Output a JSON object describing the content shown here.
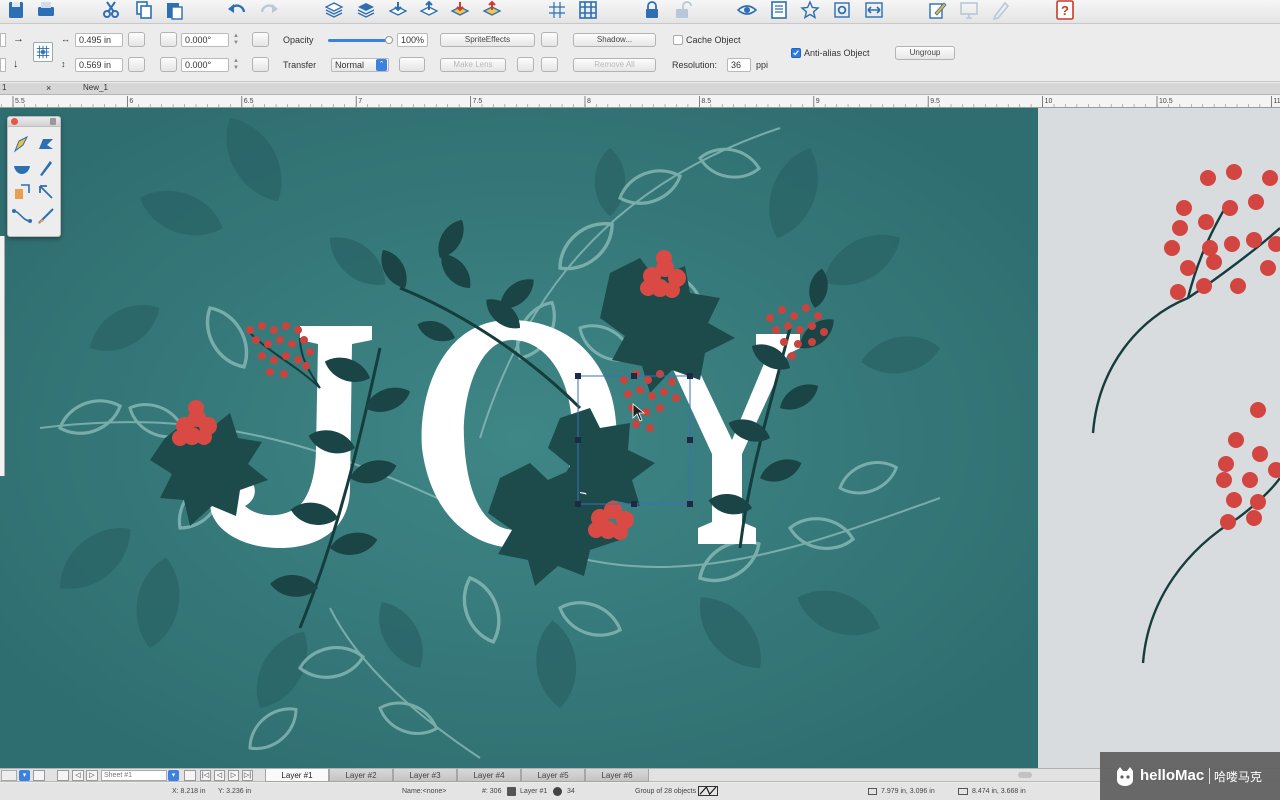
{
  "toolbar": {
    "icons": [
      "save-icon",
      "print-icon",
      "cut-icon",
      "copy-icon",
      "paste-icon",
      "undo-icon",
      "redo-icon",
      "layers-stack-icon",
      "layers-alt-icon",
      "bring-forward-icon",
      "send-backward-icon",
      "bring-to-front-icon",
      "send-to-back-icon",
      "grid-icon",
      "table-grid-icon",
      "lock-icon",
      "unlock-icon",
      "view-icon",
      "page-icon",
      "star-icon",
      "settings-icon",
      "fit-width-icon",
      "edit-icon",
      "monitor-icon",
      "pen-icon",
      "help-icon"
    ]
  },
  "props": {
    "width_value": "0.495 in",
    "height_value": "0.569 in",
    "rotation_value": "0.000°",
    "skew_value": "0.000°",
    "opacity_label": "Opacity",
    "opacity_value": "100%",
    "opacity_level": 1.0,
    "transfer_label": "Transfer",
    "transfer_value": "Normal",
    "sprite_effects": "SpriteEffects",
    "make_lens": "Make Lens",
    "shadow": "Shadow...",
    "remove_all": "Remove All",
    "cache_object": "Cache Object",
    "cache_checked": false,
    "resolution_label": "Resolution:",
    "resolution_value": "36",
    "resolution_unit": "ppi",
    "antialias_label": "Anti-alias Object",
    "antialias_checked": true,
    "ungroup": "Ungroup"
  },
  "doc_tabs": {
    "left_fragment": "1",
    "close": "×",
    "name": "New_1"
  },
  "ruler": {
    "labels": [
      "5.5",
      "6",
      "6.5",
      "7",
      "7.5",
      "8",
      "8.5",
      "9",
      "9.5",
      "10",
      "10.5",
      "11"
    ]
  },
  "artwork": {
    "word": "JOY",
    "background": "#3d7f80",
    "letter_color": "#ffffff",
    "berry_color": "#d94a45",
    "holly_color": "#1e4c4c"
  },
  "layers": {
    "sheet_label": "Sheet #1",
    "tabs": [
      "Layer #1",
      "Layer #2",
      "Layer #3",
      "Layer #4",
      "Layer #5",
      "Layer #6"
    ],
    "active": "Layer #1"
  },
  "status": {
    "x": "X: 8.218 in",
    "y": "Y: 3.236 in",
    "name": "Name:<none>",
    "object_num": "#: 306",
    "layer": "Layer #1",
    "count": "34",
    "group": "Group of 28 objects",
    "size": "7.979 in, 3.096 in",
    "pos": "8.474 in, 3.668 in"
  },
  "watermark": {
    "brand": "helloMac",
    "chinese": "哈喽马克"
  }
}
